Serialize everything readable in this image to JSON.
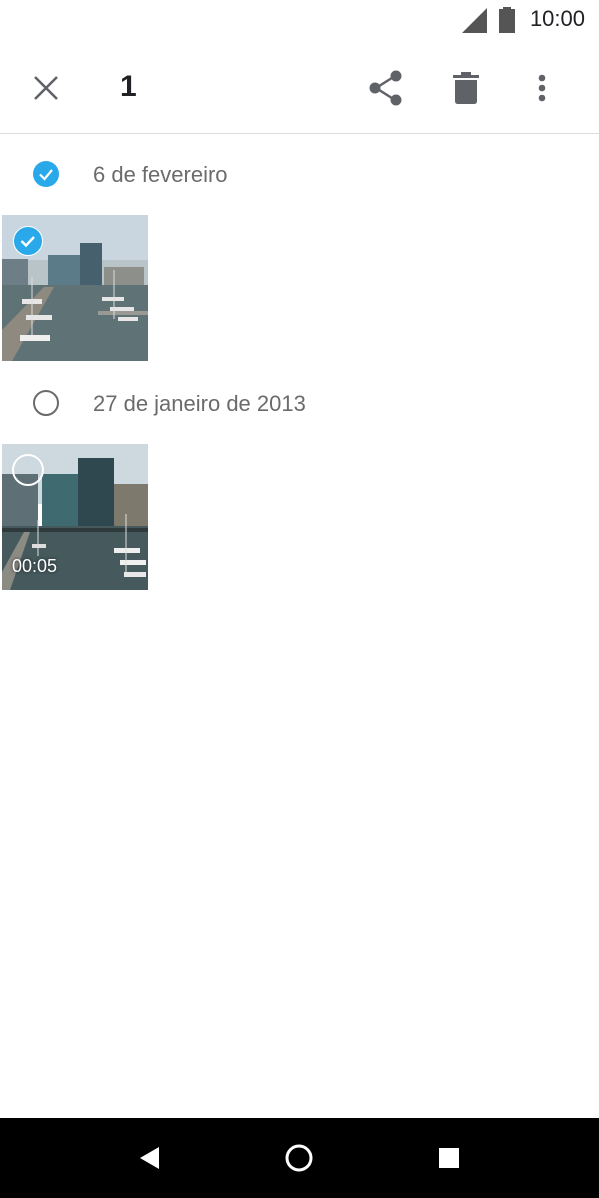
{
  "status_bar": {
    "time": "10:00"
  },
  "toolbar": {
    "selected_count": "1"
  },
  "sections": [
    {
      "label": "6 de fevereiro",
      "checked": true
    },
    {
      "label": "27 de janeiro de 2013",
      "checked": false
    }
  ],
  "items": [
    {
      "type": "photo",
      "selected": true
    },
    {
      "type": "video",
      "selected": false,
      "duration": "00:05"
    }
  ],
  "colors": {
    "accent": "#29a9ea",
    "label": "#6b6b6b",
    "icon": "#5f6368"
  },
  "icons": [
    "close-icon",
    "share-icon",
    "delete-icon",
    "more-vert-icon",
    "back-icon",
    "home-icon",
    "recents-icon"
  ]
}
